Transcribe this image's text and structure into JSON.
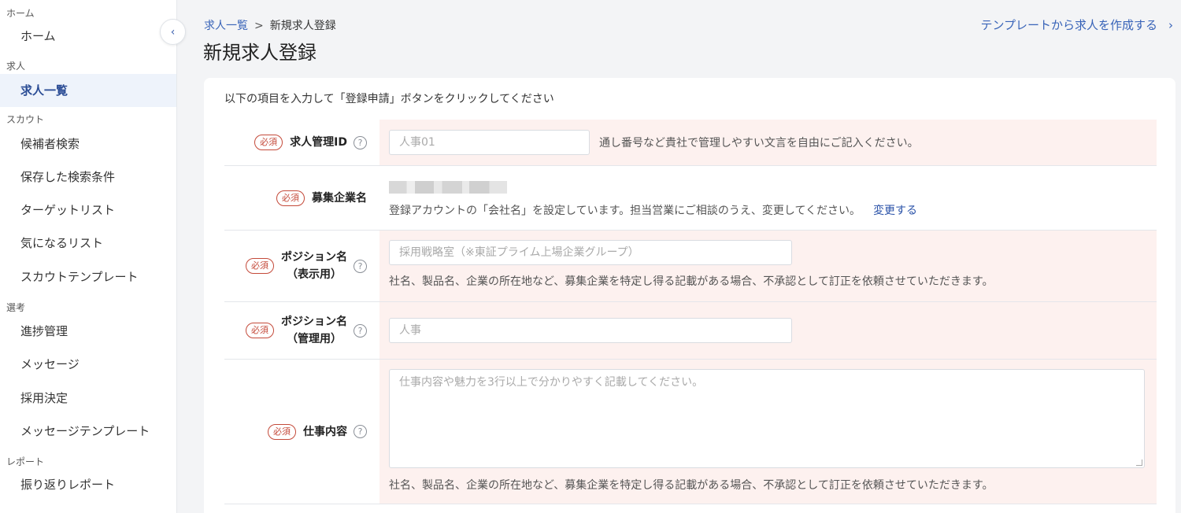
{
  "sidebar": {
    "groups": [
      {
        "label": "ホーム"
      },
      {
        "label": "求人"
      },
      {
        "label": "スカウト"
      },
      {
        "label": "選考"
      },
      {
        "label": "レポート"
      }
    ],
    "items": [
      {
        "label": "ホーム"
      },
      {
        "label": "求人一覧"
      },
      {
        "label": "候補者検索"
      },
      {
        "label": "保存した検索条件"
      },
      {
        "label": "ターゲットリスト"
      },
      {
        "label": "気になるリスト"
      },
      {
        "label": "スカウトテンプレート"
      },
      {
        "label": "進捗管理"
      },
      {
        "label": "メッセージ"
      },
      {
        "label": "採用決定"
      },
      {
        "label": "メッセージテンプレート"
      },
      {
        "label": "振り返りレポート"
      }
    ],
    "collapse_icon": "‹"
  },
  "header": {
    "breadcrumb": {
      "parent": "求人一覧",
      "sep": ">",
      "current": "新規求人登録"
    },
    "title": "新規求人登録",
    "template_link": "テンプレートから求人を作成する",
    "template_chevron": "›"
  },
  "form": {
    "intro": "以下の項目を入力して「登録申請」ボタンをクリックしてください",
    "required_badge": "必須",
    "help_icon": "?",
    "fields": {
      "job_id": {
        "label": "求人管理ID",
        "placeholder": "人事01",
        "hint": "通し番号など貴社で管理しやすい文言を自由にご記入ください。"
      },
      "company": {
        "label": "募集企業名",
        "hint": "登録アカウントの「会社名」を設定しています。担当営業にご相談のうえ、変更してください。",
        "change_link": "変更する"
      },
      "position_display": {
        "label_line1": "ポジション名",
        "label_line2": "（表示用）",
        "placeholder": "採用戦略室（※東証プライム上場企業グループ）",
        "hint": "社名、製品名、企業の所在地など、募集企業を特定し得る記載がある場合、不承認として訂正を依頼させていただきます。"
      },
      "position_manage": {
        "label_line1": "ポジション名",
        "label_line2": "（管理用）",
        "placeholder": "人事"
      },
      "job_desc": {
        "label": "仕事内容",
        "placeholder": "仕事内容や魅力を3行以上で分かりやすく記載してください。",
        "hint": "社名、製品名、企業の所在地など、募集企業を特定し得る記載がある場合、不承認として訂正を依頼させていただきます。"
      }
    }
  },
  "colors": {
    "accent": "#3863b8",
    "required": "#c44a3a",
    "highlight_bg": "#fdf1ef",
    "active_nav_bg": "#eef3fb"
  }
}
